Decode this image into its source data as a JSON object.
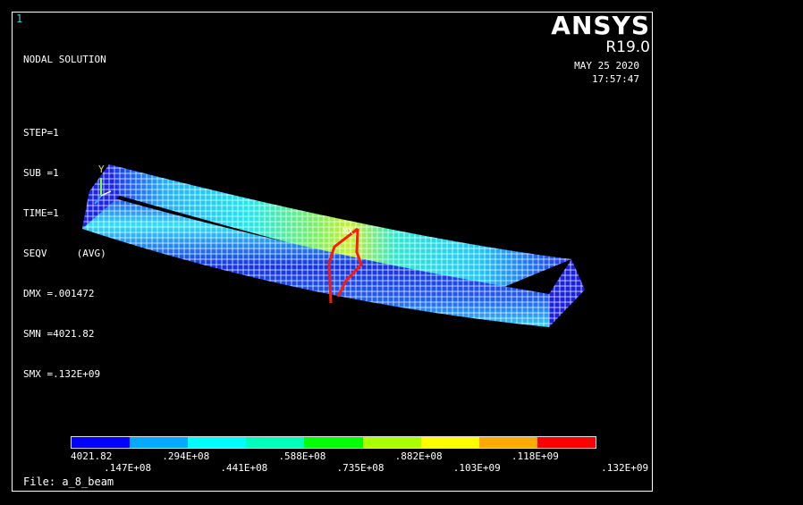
{
  "window": {
    "number": "1"
  },
  "brand": {
    "name": "ANSYS",
    "version": "R19.0"
  },
  "timestamp": {
    "date": "MAY 25 2020",
    "time": "17:57:47"
  },
  "solution": {
    "title": "NODAL SOLUTION",
    "step": "STEP=1",
    "sub": "SUB =1",
    "time": "TIME=1",
    "item": "SEQV     (AVG)",
    "dmx": "DMX =.001472",
    "smn": "SMN =4021.82",
    "smx": "SMX =.132E+09"
  },
  "axis": {
    "y_label": "Y"
  },
  "markers": {
    "max": "MX"
  },
  "legend": {
    "colors": [
      "#0000ff",
      "#00aaff",
      "#00ffff",
      "#00ffbb",
      "#00ff00",
      "#aaff00",
      "#ffff00",
      "#ffaa00",
      "#ff0000"
    ],
    "labels_top": [
      "4021.82",
      ".294E+08",
      ".588E+08",
      ".882E+08",
      ".118E+09"
    ],
    "labels_bottom": [
      ".147E+08",
      ".441E+08",
      ".735E+08",
      ".103E+09",
      ".132E+09"
    ]
  },
  "file": {
    "label": "File: a_8_beam"
  }
}
